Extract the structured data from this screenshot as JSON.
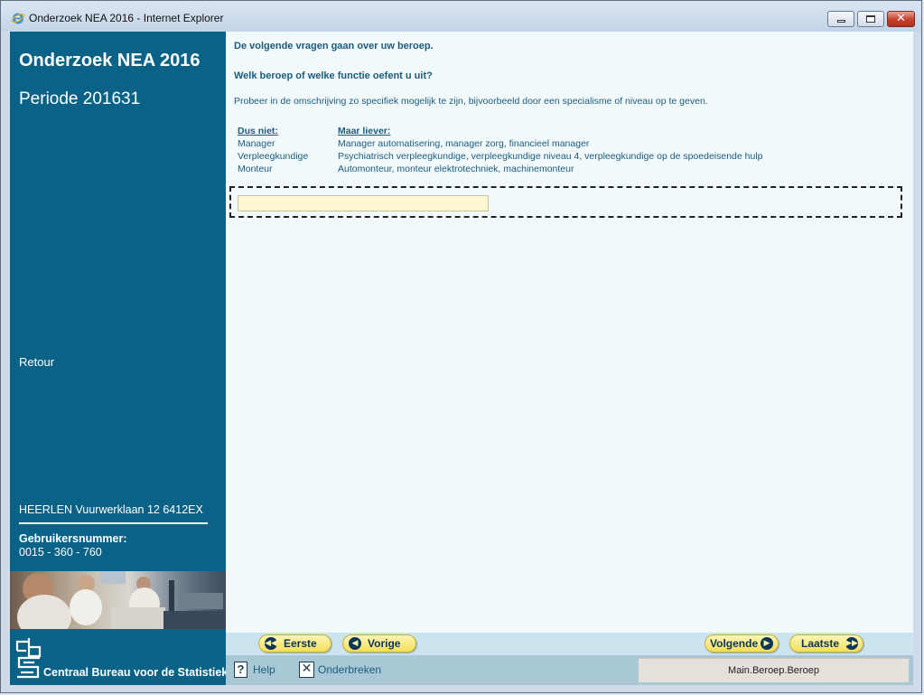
{
  "window": {
    "title": "Onderzoek NEA 2016 - Internet Explorer"
  },
  "sidebar": {
    "title": "Onderzoek NEA 2016",
    "period": "Periode 201631",
    "retour": "Retour",
    "address": "HEERLEN Vuurwerklaan 12 6412EX",
    "user_label": "Gebruikersnummer:",
    "user_number": "0015 - 360 - 760",
    "org_name": "Centraal Bureau voor de Statistiek"
  },
  "question": {
    "intro": "De volgende vragen gaan over uw beroep.",
    "text": "Welk beroep of welke functie oefent u uit?",
    "hint": "Probeer in de omschrijving zo specifiek mogelijk te zijn, bijvoorbeeld door een specialisme of niveau op te geven.",
    "examples": {
      "header_not": "Dus niet:",
      "header_rather": "Maar liever:",
      "rows": [
        {
          "not": "Manager",
          "rather": "Manager automatisering, manager zorg, financieel manager"
        },
        {
          "not": "Verpleegkundige",
          "rather": "Psychiatrisch verpleegkundige, verpleegkundige niveau 4, verpleegkundige op de spoedeisende hulp"
        },
        {
          "not": "Monteur",
          "rather": "Automonteur, monteur elektrotechniek, machinemonteur"
        }
      ]
    },
    "answer_value": ""
  },
  "nav": {
    "first": "Eerste",
    "previous": "Vorige",
    "next": "Volgende",
    "last": "Laatste"
  },
  "footer": {
    "help": "Help",
    "cancel": "Onderbreken",
    "status": "Main.Beroep.Beroep"
  },
  "colors": {
    "sidebar": "#0b6287",
    "text": "#1c5c7e",
    "button": "#f2df5b",
    "input": "#fdf7d2"
  },
  "icons": [
    "ie-icon",
    "minimize-icon",
    "maximize-icon",
    "close-icon",
    "cbs-logo",
    "arrow-left-icon",
    "arrow-right-icon",
    "help-icon",
    "cancel-icon"
  ]
}
